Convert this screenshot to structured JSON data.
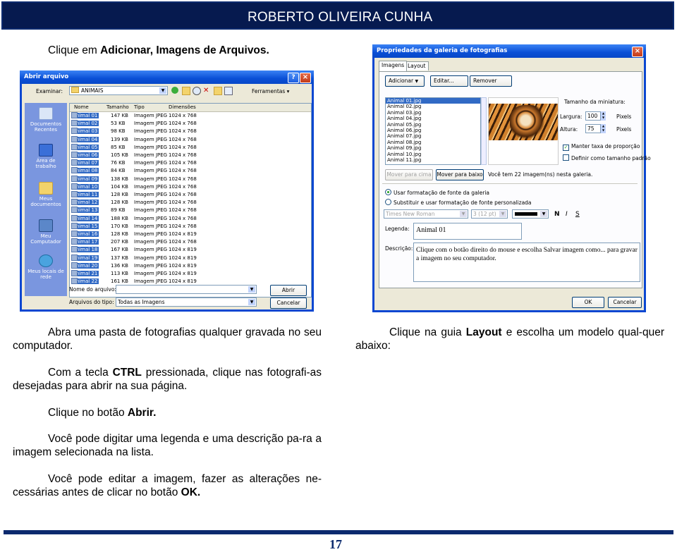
{
  "header": {
    "title": "ROBERTO OLIVEIRA CUNHA"
  },
  "left_text": {
    "p1_pre": "Clique em ",
    "p1_bold": "Adicionar, Imagens de Arquivos.",
    "p2": "Abra uma pasta de fotografias qualquer gravada no seu computador.",
    "p3_pre": "Com a tecla ",
    "p3_bold": "CTRL",
    "p3_post": " pressionada, clique nas fotografi-as desejadas para abrir na sua página.",
    "p4_pre": "Clique no botão ",
    "p4_bold": "Abrir.",
    "p5": "Você pode digitar uma legenda e uma descrição pa-ra a imagem selecionada na lista.",
    "p6_pre": "Você pode editar a imagem, fazer as alterações ne-cessárias antes de clicar no botão ",
    "p6_bold": "OK."
  },
  "right_text": {
    "p1_pre": "Clique na guia ",
    "p1_bold": "Layout",
    "p1_post": " e escolha um modelo qual-quer abaixo:"
  },
  "open_dialog": {
    "title": "Abrir arquivo",
    "examinar_label": "Examinar:",
    "folder": "ANIMAIS",
    "tools_label": "Ferramentas",
    "places": [
      "Documentos Recentes",
      "Área de trabalho",
      "Meus documentos",
      "Meu Computador",
      "Meus locais de rede"
    ],
    "columns": [
      "Nome",
      "Tamanho",
      "Tipo",
      "Dimensões"
    ],
    "files": [
      {
        "name": "Animal 01",
        "size": "147 KB",
        "type": "Imagem JPEG",
        "dim": "1024 x 768"
      },
      {
        "name": "Animal 02",
        "size": "53 KB",
        "type": "Imagem JPEG",
        "dim": "1024 x 768"
      },
      {
        "name": "Animal 03",
        "size": "98 KB",
        "type": "Imagem JPEG",
        "dim": "1024 x 768"
      },
      {
        "name": "Animal 04",
        "size": "139 KB",
        "type": "Imagem JPEG",
        "dim": "1024 x 768"
      },
      {
        "name": "Animal 05",
        "size": "85 KB",
        "type": "Imagem JPEG",
        "dim": "1024 x 768"
      },
      {
        "name": "Animal 06",
        "size": "105 KB",
        "type": "Imagem JPEG",
        "dim": "1024 x 768"
      },
      {
        "name": "Animal 07",
        "size": "76 KB",
        "type": "Imagem JPEG",
        "dim": "1024 x 768"
      },
      {
        "name": "Animal 08",
        "size": "84 KB",
        "type": "Imagem JPEG",
        "dim": "1024 x 768"
      },
      {
        "name": "Animal 09",
        "size": "138 KB",
        "type": "Imagem JPEG",
        "dim": "1024 x 768"
      },
      {
        "name": "Animal 10",
        "size": "104 KB",
        "type": "Imagem JPEG",
        "dim": "1024 x 768"
      },
      {
        "name": "Animal 11",
        "size": "128 KB",
        "type": "Imagem JPEG",
        "dim": "1024 x 768"
      },
      {
        "name": "Animal 12",
        "size": "128 KB",
        "type": "Imagem JPEG",
        "dim": "1024 x 768"
      },
      {
        "name": "Animal 13",
        "size": "89 KB",
        "type": "Imagem JPEG",
        "dim": "1024 x 768"
      },
      {
        "name": "Animal 14",
        "size": "188 KB",
        "type": "Imagem JPEG",
        "dim": "1024 x 768"
      },
      {
        "name": "Animal 15",
        "size": "170 KB",
        "type": "Imagem JPEG",
        "dim": "1024 x 768"
      },
      {
        "name": "Animal 16",
        "size": "128 KB",
        "type": "Imagem JPEG",
        "dim": "1024 x 819"
      },
      {
        "name": "Animal 17",
        "size": "207 KB",
        "type": "Imagem JPEG",
        "dim": "1024 x 768"
      },
      {
        "name": "Animal 18",
        "size": "167 KB",
        "type": "Imagem JPEG",
        "dim": "1024 x 819"
      },
      {
        "name": "Animal 19",
        "size": "137 KB",
        "type": "Imagem JPEG",
        "dim": "1024 x 819"
      },
      {
        "name": "Animal 20",
        "size": "136 KB",
        "type": "Imagem JPEG",
        "dim": "1024 x 819"
      },
      {
        "name": "Animal 21",
        "size": "113 KB",
        "type": "Imagem JPEG",
        "dim": "1024 x 819"
      },
      {
        "name": "Animal 22",
        "size": "161 KB",
        "type": "Imagem JPEG",
        "dim": "1024 x 819"
      }
    ],
    "filename_label": "Nome do arquivo:",
    "filetype_label": "Arquivos do tipo:",
    "filetype_value": "Todas as Imagens",
    "open_button": "Abrir",
    "cancel_button": "Cancelar"
  },
  "props_dialog": {
    "title": "Propriedades da galeria de fotografias",
    "tabs": [
      "Imagens",
      "Layout"
    ],
    "add_button": "Adicionar",
    "edit_button": "Editar...",
    "remove_button": "Remover",
    "images": [
      "Animal 01.jpg",
      "Animal 02.jpg",
      "Animal 03.jpg",
      "Animal 04.jpg",
      "Animal 05.jpg",
      "Animal 06.jpg",
      "Animal 07.jpg",
      "Animal 08.jpg",
      "Animal 09.jpg",
      "Animal 10.jpg",
      "Animal 11.jpg"
    ],
    "thumb_size_label": "Tamanho da miniatura:",
    "width_label": "Largura:",
    "width_value": "100",
    "height_label": "Altura:",
    "height_value": "75",
    "unit": "Pixels",
    "keep_ratio": "Manter taxa de proporção",
    "set_default": "Definir como tamanho padrão",
    "move_up": "Mover para cima",
    "move_down": "Mover para baixo",
    "count_text": "Você tem 22 imagem(ns) nesta galeria.",
    "radio_use_format": "Usar formatação de fonte da galeria",
    "radio_custom_format": "Substituir e usar formatação de fonte personalizada",
    "font_name": "Times New Roman",
    "font_size": "3  (12 pt)",
    "bold_btn": "N",
    "italic_btn": "I",
    "underline_btn": "S",
    "caption_label": "Legenda:",
    "caption_value": "Animal 01",
    "description_label": "Descrição:",
    "description_value": "Clique com o botão direito do mouse e escolha Salvar imagem como... para gravar a imagem no seu computador.",
    "ok_button": "OK",
    "cancel_button": "Cancelar"
  },
  "page_number": "17"
}
